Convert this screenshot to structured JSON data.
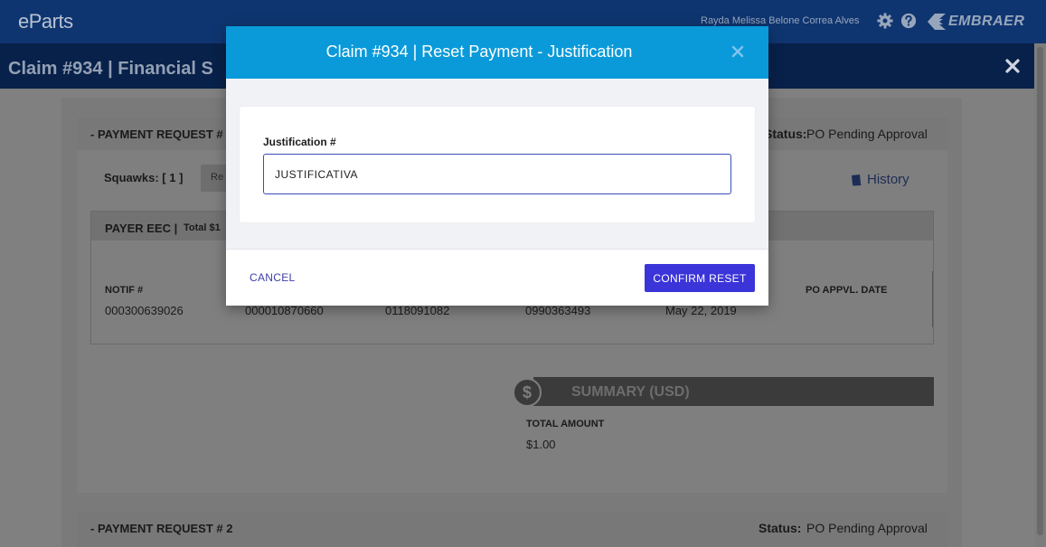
{
  "app": {
    "logo": "eParts",
    "user_name": "Rayda Melissa Belone Correa Alves",
    "brand": "EMBRAER",
    "icons": {
      "settings": "gear-icon",
      "help": "help-icon"
    }
  },
  "page": {
    "title": "Claim #934 | Financial S"
  },
  "background": {
    "payment_request_1": {
      "title": "- PAYMENT REQUEST #",
      "status_label": "Status:",
      "status_value": "PO Pending Approval"
    },
    "squawks_label": "Squawks: [ 1 ]",
    "pill_label": "Re",
    "history_label": "History",
    "payer": {
      "title": "PAYER EEC |",
      "total": "Total $1",
      "columns": [
        "NOTIF #",
        "PO APPVL. DATE"
      ],
      "row": [
        "000300639026",
        "000010870660",
        "0118091082",
        "0990363493",
        "May 22, 2019"
      ]
    },
    "summary": {
      "dollar": "$",
      "title": "SUMMARY (USD)",
      "total_label": "TOTAL AMOUNT",
      "total_value": "$1.00"
    },
    "payment_request_2": {
      "title": "- PAYMENT REQUEST # 2",
      "status_label": "Status:",
      "status_value": "PO Pending Approval"
    }
  },
  "modal": {
    "title": "Claim #934 | Reset Payment - Justification",
    "field_label": "Justification #",
    "field_value": "JUSTIFICATIVA",
    "cancel_label": "CANCEL",
    "confirm_label": "CONFIRM RESET",
    "colors": {
      "header": "#0a9ad9",
      "confirm": "#3b34d8",
      "cancel_text": "#3d3dab"
    }
  }
}
